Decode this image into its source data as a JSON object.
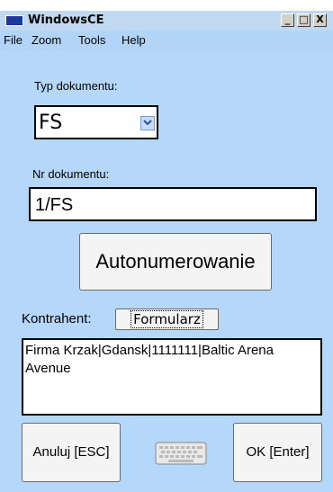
{
  "window": {
    "title": "WindowsCE"
  },
  "titlebar_buttons": {
    "minimize": "_",
    "maximize": "□",
    "close": "X"
  },
  "menu": [
    "File",
    "Zoom",
    "Tools",
    "Help"
  ],
  "form": {
    "doc_type_label": "Typ dokumentu:",
    "doc_type_value": "FS",
    "doc_number_label": "Nr dokumentu:",
    "doc_number_value": "1/FS",
    "autonumber_button": "Autonumerowanie",
    "contractor_label": "Kontrahent:",
    "form_button": "Formularz",
    "contractor_text": "Firma Krzak|Gdansk|1111111|Baltic Arena Avenue"
  },
  "footer": {
    "cancel_button": "Anuluj [ESC]",
    "ok_button": "OK [Enter]",
    "keyboard_icon": "keyboard-icon"
  },
  "colors": {
    "background": "#b5d7f9",
    "titlebar": "#c0d8f0",
    "menubar": "#b2d4f7"
  }
}
